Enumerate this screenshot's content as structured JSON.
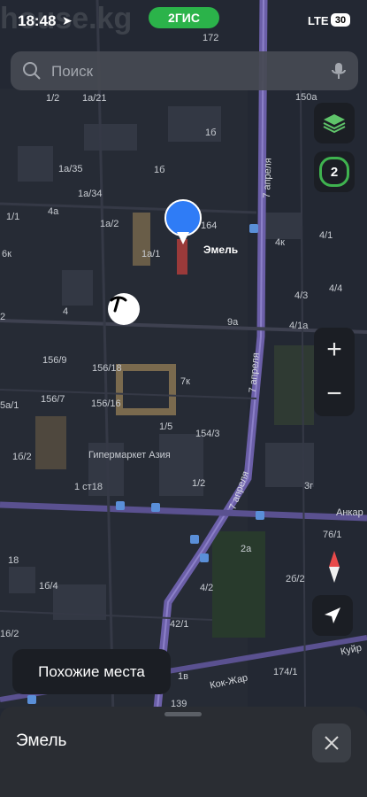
{
  "status_bar": {
    "time": "18:48",
    "brand": "2ГИС",
    "network": "LTE",
    "battery": "30"
  },
  "search": {
    "placeholder": "Поиск"
  },
  "map": {
    "pin_label": "Эмель",
    "roads": [
      "7 апреля",
      "7 апреля",
      "7 апреля",
      "Анкар",
      "Кок-Жар",
      "Куйр"
    ],
    "house_numbers": [
      "172",
      "1/2",
      "1а/21",
      "1б",
      "150а",
      "1а/35",
      "1б",
      "1а/34",
      "1/1",
      "4а",
      "1а/2",
      "164",
      "4к",
      "4/1",
      "6к",
      "1а/1",
      "4/3",
      "4/4",
      "2",
      "4",
      "9а",
      "4/1а",
      "156/9",
      "156/18",
      "7к",
      "156/7",
      "156/16",
      "5а/1",
      "1/5",
      "154/3",
      "1б/2",
      "1/2",
      "1 ст18",
      "3г",
      "76/1",
      "2а",
      "18",
      "2б/2",
      "1б/4",
      "4/2",
      "16/2",
      "42/1",
      "1в",
      "174/1",
      "139"
    ],
    "poi": [
      "Гипермаркет Азия"
    ],
    "watermark": "house.kg"
  },
  "controls": {
    "layers_badge": "2",
    "zoom_in": "+",
    "zoom_out": "−"
  },
  "similar_places": {
    "label": "Похожие места"
  },
  "bottom_sheet": {
    "title": "Эмель"
  }
}
